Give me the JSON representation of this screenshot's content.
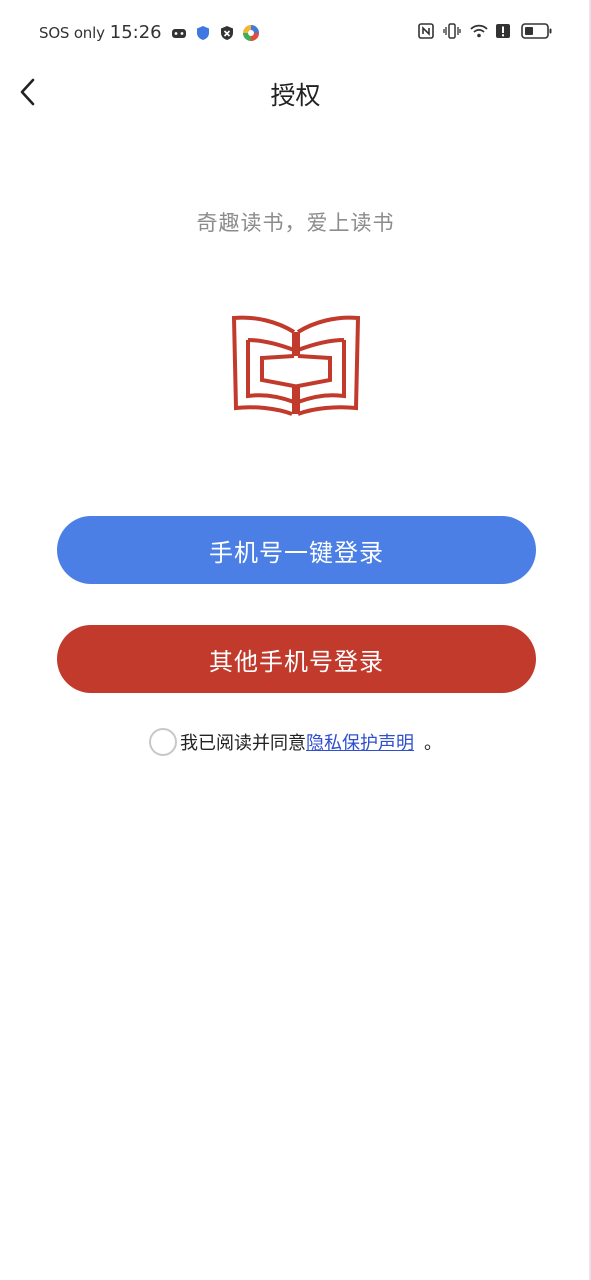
{
  "status_bar": {
    "carrier": "SOS only",
    "time": "15:26",
    "left_icons": [
      "game-controller-icon",
      "shield-icon",
      "security-icon",
      "app-colorful-icon"
    ],
    "right_icons": [
      "nfc-icon",
      "vibrate-icon",
      "wifi-icon",
      "alert-icon",
      "battery-icon"
    ]
  },
  "header": {
    "title": "授权",
    "back_icon": "chevron-left-icon"
  },
  "slogan": "奇趣读书，爱上读书",
  "logo": {
    "icon": "open-book-logo",
    "color": "#c13a2c"
  },
  "buttons": {
    "one_key_login": "手机号一键登录",
    "other_phone_login": "其他手机号登录"
  },
  "agreement": {
    "prefix": "我已阅读并同意",
    "link": "隐私保护声明",
    "suffix": "。",
    "checked": false
  },
  "colors": {
    "primary_blue": "#4b7fe6",
    "brand_red": "#c13a2c",
    "link_blue": "#2f4fcf",
    "slogan_gray": "#8c8c8c"
  }
}
